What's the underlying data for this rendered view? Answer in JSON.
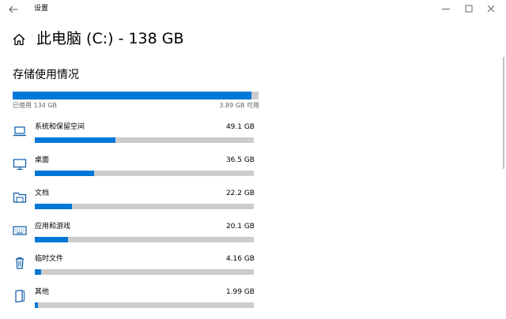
{
  "window": {
    "title": "设置"
  },
  "header": {
    "title": "此电脑 (C:) - 138 GB"
  },
  "section": {
    "title": "存储使用情况"
  },
  "usage": {
    "used": "已使用 134 GB",
    "free": "3.89 GB 可用",
    "used_fraction": 0.972
  },
  "categories": [
    {
      "label": "系统和保留空间",
      "size": "49.1 GB",
      "fraction": 0.37,
      "icon": "laptop-icon"
    },
    {
      "label": "桌面",
      "size": "36.5 GB",
      "fraction": 0.27,
      "icon": "monitor-icon"
    },
    {
      "label": "文档",
      "size": "22.2 GB",
      "fraction": 0.17,
      "icon": "folder-icon"
    },
    {
      "label": "应用和游戏",
      "size": "20.1 GB",
      "fraction": 0.15,
      "icon": "keyboard-icon"
    },
    {
      "label": "临时文件",
      "size": "4.16 GB",
      "fraction": 0.03,
      "icon": "trash-icon"
    },
    {
      "label": "其他",
      "size": "1.99 GB",
      "fraction": 0.015,
      "icon": "document-icon"
    }
  ],
  "colors": {
    "accent": "#0078d7",
    "track": "#cccccc",
    "secondary_text": "#666666"
  }
}
